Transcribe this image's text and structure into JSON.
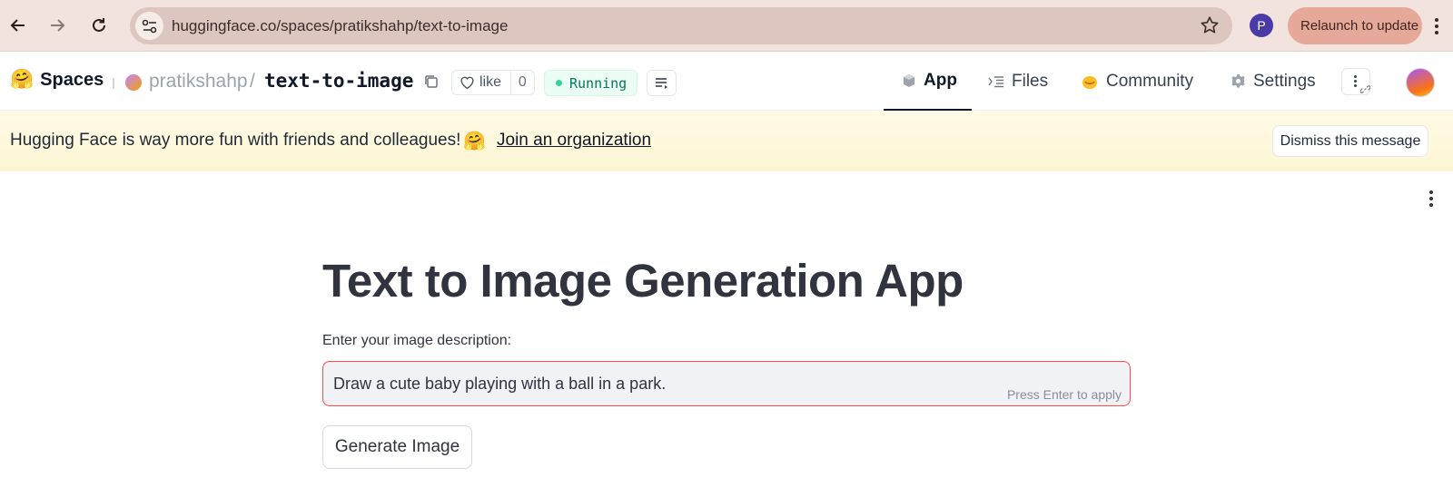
{
  "browser": {
    "url": "huggingface.co/spaces/pratikshahp/text-to-image",
    "profile_initial": "P",
    "relaunch_label": "Relaunch to update"
  },
  "header": {
    "brand_emoji": "🤗",
    "brand_name": "Spaces",
    "owner": "pratikshahp",
    "separator": "/",
    "space_name": "text-to-image",
    "like_label": "like",
    "like_count": "0",
    "status": "Running",
    "status_color": "#047857",
    "tabs": [
      {
        "label": "App",
        "icon": "cube-icon",
        "active": true
      },
      {
        "label": "Files",
        "icon": "files-icon",
        "active": false
      },
      {
        "label": "Community",
        "icon": "community-hands-icon",
        "active": false
      },
      {
        "label": "Settings",
        "icon": "gear-icon",
        "active": false
      }
    ]
  },
  "banner": {
    "message": "Hugging Face is way more fun with friends and colleagues!",
    "emoji": "🤗",
    "link_label": "Join an organization",
    "dismiss_label": "Dismiss this message"
  },
  "app": {
    "title": "Text to Image Generation App",
    "input_label": "Enter your image description:",
    "input_value": "Draw a cute baby playing with a ball in a park.",
    "input_hint": "Press Enter to apply",
    "button_label": "Generate Image",
    "accent_color": "#ff4b4b"
  }
}
